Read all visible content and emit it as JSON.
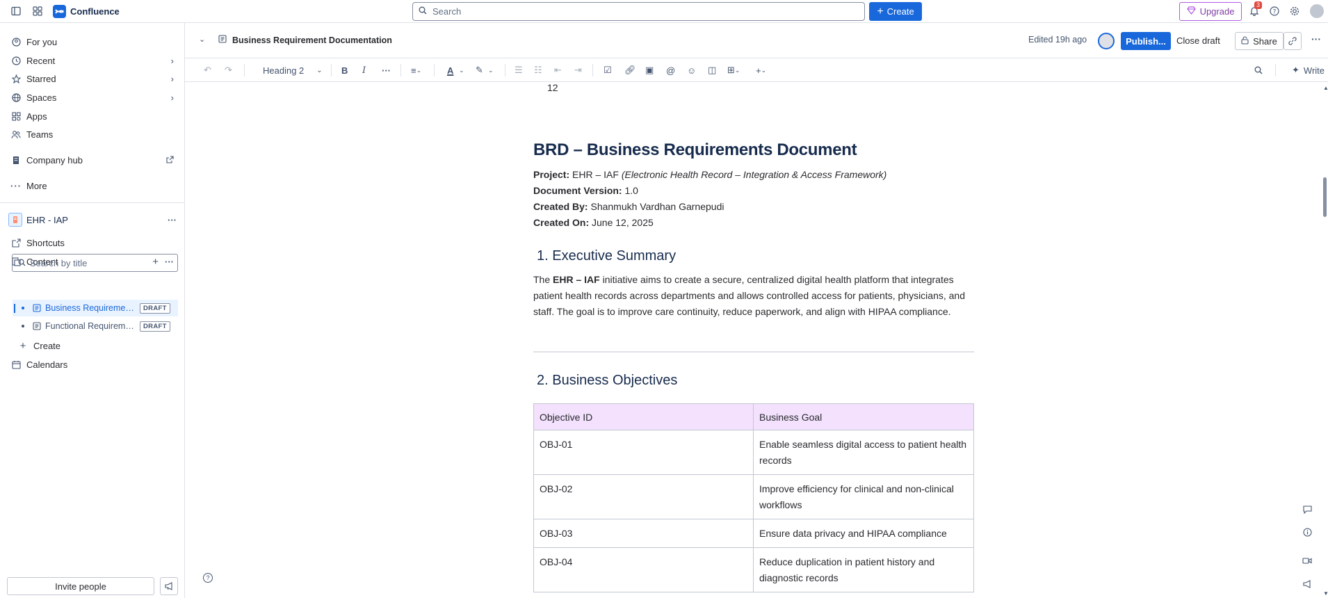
{
  "topnav": {
    "app_name": "Confluence",
    "search_placeholder": "Search",
    "create_label": "Create",
    "upgrade_label": "Upgrade",
    "notifications_count": "3"
  },
  "sidebar": {
    "items": [
      {
        "label": "For you",
        "icon": "user-circle-icon"
      },
      {
        "label": "Recent",
        "icon": "clock-icon"
      },
      {
        "label": "Starred",
        "icon": "star-icon"
      },
      {
        "label": "Spaces",
        "icon": "globe-icon"
      },
      {
        "label": "Apps",
        "icon": "apps-icon"
      },
      {
        "label": "Teams",
        "icon": "people-icon"
      },
      {
        "label": "Company hub",
        "icon": "building-icon"
      },
      {
        "label": "More",
        "icon": "more-icon"
      }
    ],
    "space_name": "EHR - IAP",
    "shortcuts_label": "Shortcuts",
    "content_label": "Content",
    "search_placeholder": "Search by title",
    "pages": [
      {
        "title": "Business Requirement Documentation",
        "status": "DRAFT"
      },
      {
        "title": "Functional Requirement Documentation",
        "status": "DRAFT"
      }
    ],
    "create_label": "Create",
    "calendars_label": "Calendars",
    "invite_label": "Invite people"
  },
  "pagebar": {
    "title": "Business Requirement Documentation",
    "edited": "Edited 19h ago",
    "publish_label": "Publish...",
    "close_draft_label": "Close draft",
    "share_label": "Share"
  },
  "toolbar": {
    "heading_style": "Heading 2",
    "write_label": "Write"
  },
  "doc": {
    "line_number": "12",
    "title": "BRD – Business Requirements Document",
    "project_label": "Project:",
    "project_value": "EHR – IAF",
    "project_desc": "(Electronic Health Record – Integration & Access Framework)",
    "version_label": "Document Version:",
    "version_value": "1.0",
    "created_by_label": "Created By:",
    "created_by_value": "Shanmukh Vardhan Garnepudi",
    "created_on_label": "Created On:",
    "created_on_value": "June 12, 2025",
    "section1_title": "1. Executive Summary",
    "summary_pre": "The ",
    "summary_bold": "EHR – IAF",
    "summary_rest": " initiative aims to create a secure, centralized digital health platform that integrates patient health records across departments and allows controlled access for patients, physicians, and staff. The goal is to improve care continuity, reduce paperwork, and align with HIPAA compliance.",
    "section2_title": "2. Business Objectives",
    "table_headers": [
      "Objective ID",
      "Business Goal"
    ],
    "table_rows": [
      [
        "OBJ-01",
        "Enable seamless digital access to patient health records"
      ],
      [
        "OBJ-02",
        "Improve efficiency for clinical and non-clinical workflows"
      ],
      [
        "OBJ-03",
        "Ensure data privacy and HIPAA compliance"
      ],
      [
        "OBJ-04",
        "Reduce duplication in patient history and diagnostic records"
      ]
    ]
  },
  "colors": {
    "brand": "#1868db",
    "table_header_bg": "#f3e1fd",
    "upgrade_border": "#af59e1"
  }
}
